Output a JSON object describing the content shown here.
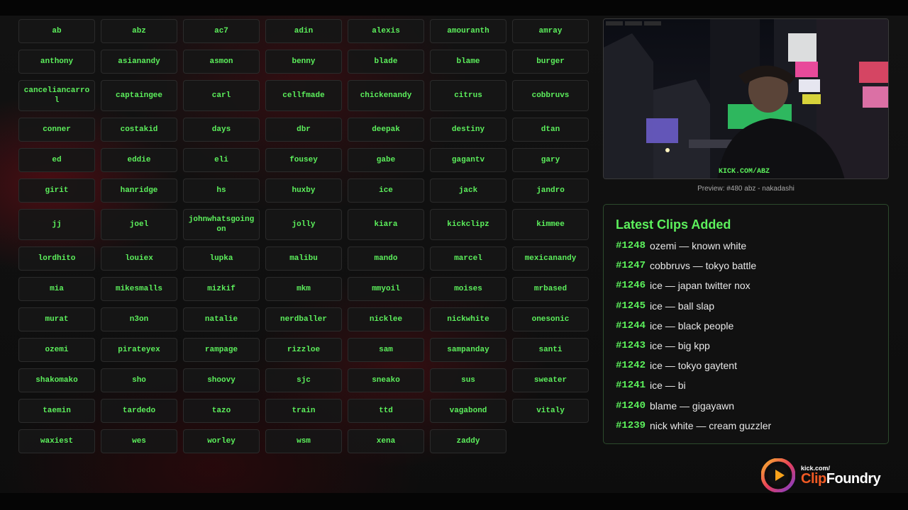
{
  "streamers": [
    "ab",
    "abz",
    "ac7",
    "adin",
    "alexis",
    "amouranth",
    "amray",
    "anthony",
    "asianandy",
    "asmon",
    "benny",
    "blade",
    "blame",
    "burger",
    "canceliancarrol",
    "captaingee",
    "carl",
    "cellfmade",
    "chickenandy",
    "citrus",
    "cobbruvs",
    "conner",
    "costakid",
    "days",
    "dbr",
    "deepak",
    "destiny",
    "dtan",
    "ed",
    "eddie",
    "eli",
    "fousey",
    "gabe",
    "gagantv",
    "gary",
    "girit",
    "hanridge",
    "hs",
    "huxby",
    "ice",
    "jack",
    "jandro",
    "jj",
    "joel",
    "johnwhatsgoingon",
    "jolly",
    "kiara",
    "kickclipz",
    "kimmee",
    "lordhito",
    "louiex",
    "lupka",
    "malibu",
    "mando",
    "marcel",
    "mexicanandy",
    "mia",
    "mikesmalls",
    "mizkif",
    "mkm",
    "mmyoil",
    "moises",
    "mrbased",
    "murat",
    "n3on",
    "natalie",
    "nerdballer",
    "nicklee",
    "nickwhite",
    "onesonic",
    "ozemi",
    "pirateyex",
    "rampage",
    "rizzloe",
    "sam",
    "sampanday",
    "santi",
    "shakomako",
    "sho",
    "shoovy",
    "sjc",
    "sneako",
    "sus",
    "sweater",
    "taemin",
    "tardedo",
    "tazo",
    "train",
    "ttd",
    "vagabond",
    "vitaly",
    "waxiest",
    "wes",
    "worley",
    "wsm",
    "xena",
    "zaddy"
  ],
  "preview": {
    "caption": "Preview: #480 abz - nakadashi",
    "overlay_text": "KICK.COM/ABZ"
  },
  "latest_clips": {
    "title": "Latest Clips Added",
    "items": [
      {
        "id": "#1248",
        "text": "ozemi — known white"
      },
      {
        "id": "#1247",
        "text": "cobbruvs — tokyo battle"
      },
      {
        "id": "#1246",
        "text": "ice — japan twitter nox"
      },
      {
        "id": "#1245",
        "text": "ice — ball slap"
      },
      {
        "id": "#1244",
        "text": "ice — black people"
      },
      {
        "id": "#1243",
        "text": "ice — big kpp"
      },
      {
        "id": "#1242",
        "text": "ice — tokyo gaytent"
      },
      {
        "id": "#1241",
        "text": "ice — bi"
      },
      {
        "id": "#1240",
        "text": "blame — gigayawn"
      },
      {
        "id": "#1239",
        "text": "nick white — cream guzzler"
      }
    ]
  },
  "brand": {
    "small": "kick.com/",
    "clip": "Clip",
    "foundry": "Foundry"
  },
  "colors": {
    "accent_green": "#5cf05c",
    "brand_orange": "#f15a24",
    "background": "#0a0a0a"
  }
}
